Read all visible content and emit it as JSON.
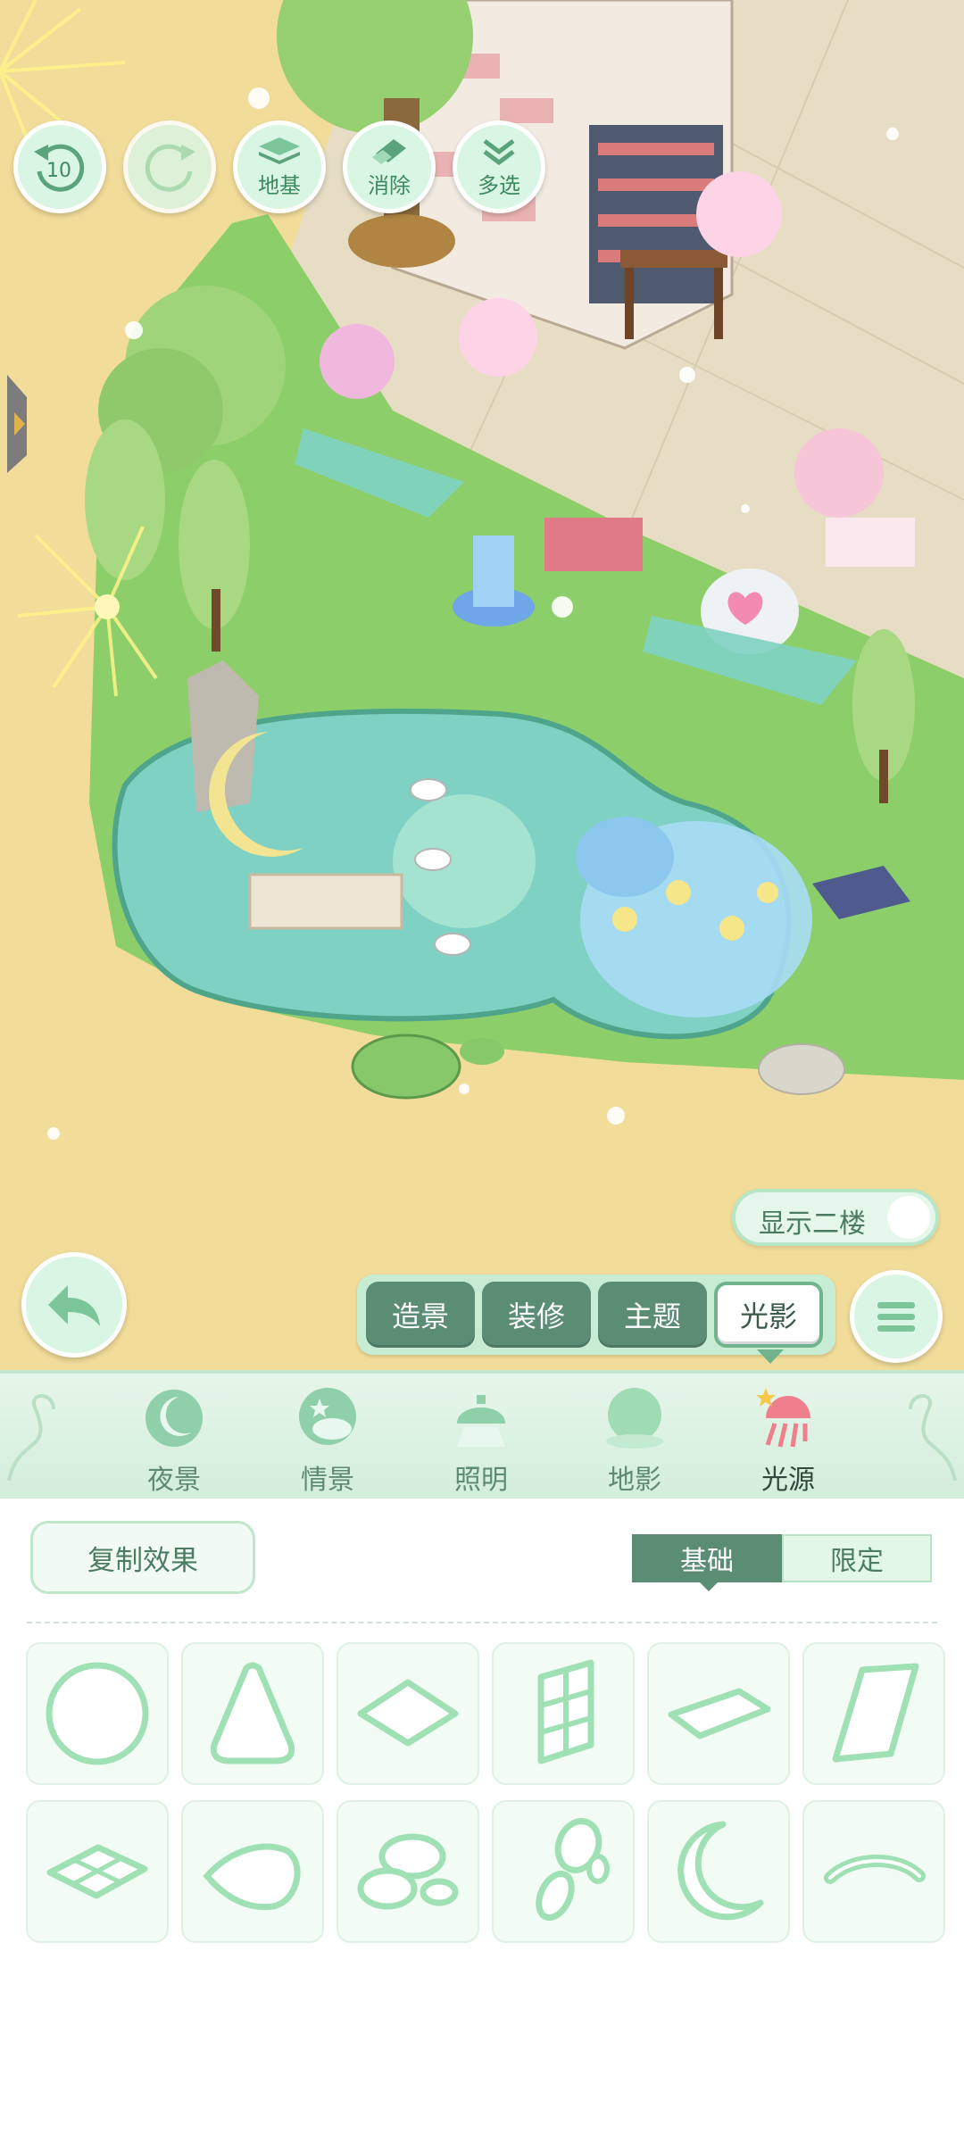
{
  "toolbar": {
    "undo_count": "10",
    "foundation_label": "地基",
    "erase_label": "消除",
    "multiselect_label": "多选"
  },
  "second_floor_toggle": {
    "label": "显示二楼",
    "state": "off"
  },
  "mode_tabs": [
    {
      "label": "造景",
      "active": false
    },
    {
      "label": "装修",
      "active": false
    },
    {
      "label": "主题",
      "active": false
    },
    {
      "label": "光影",
      "active": true
    }
  ],
  "categories": [
    {
      "label": "夜景",
      "icon": "moon-icon"
    },
    {
      "label": "情景",
      "icon": "scene-cloud-icon"
    },
    {
      "label": "照明",
      "icon": "lamp-icon"
    },
    {
      "label": "地影",
      "icon": "ground-shadow-icon"
    },
    {
      "label": "光源",
      "icon": "light-source-icon",
      "active": true
    }
  ],
  "panel": {
    "copy_label": "复制效果",
    "tab_basic": "基础",
    "tab_limited": "限定",
    "active_tab": "基础",
    "shapes": [
      "circle",
      "cone",
      "diamond",
      "window",
      "flat-diamond",
      "trapezoid",
      "grid-diamond",
      "leaf",
      "cloud",
      "blob-chain",
      "crescent",
      "arc"
    ]
  },
  "colors": {
    "accent_green": "#5b8c74",
    "light_green": "#d9f5e3",
    "sand": "#f2dc9a",
    "grass": "#8ccf6a",
    "water": "#7fd1c3"
  }
}
